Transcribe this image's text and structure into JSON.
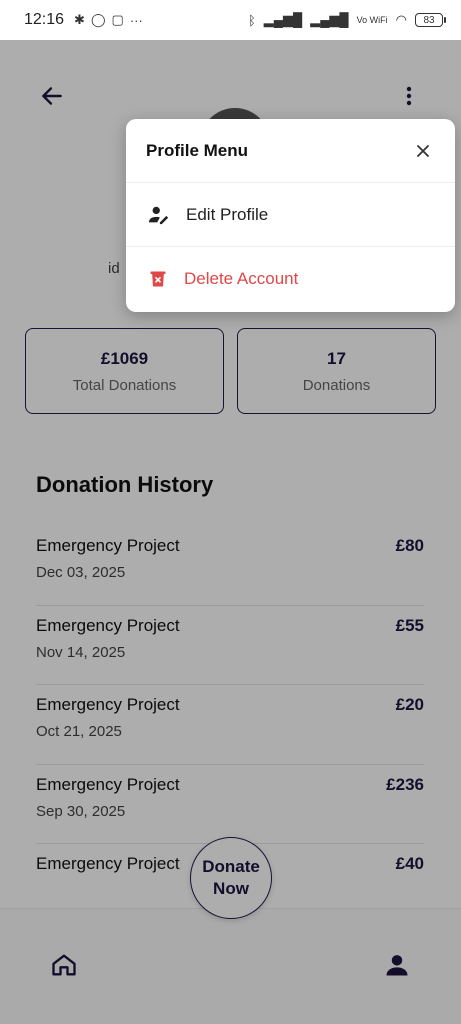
{
  "status_bar": {
    "time": "12:16",
    "left_icons": [
      "slack-icon",
      "whatsapp-icon",
      "calendar-icon",
      "more-dots-icon"
    ],
    "network_label": "Vo WiFi",
    "battery": "83"
  },
  "profile": {
    "handle": "id"
  },
  "stats": [
    {
      "value": "£1069",
      "label": "Total Donations"
    },
    {
      "value": "17",
      "label": "Donations"
    }
  ],
  "history": {
    "title": "Donation History",
    "items": [
      {
        "title": "Emergency Project",
        "date": "Dec 03, 2025",
        "amount": "£80"
      },
      {
        "title": "Emergency Project",
        "date": "Nov 14, 2025",
        "amount": "£55"
      },
      {
        "title": "Emergency Project",
        "date": "Oct 21, 2025",
        "amount": "£20"
      },
      {
        "title": "Emergency Project",
        "date": "Sep 30, 2025",
        "amount": "£236"
      },
      {
        "title": "Emergency Project",
        "date": "",
        "amount": "£40"
      }
    ]
  },
  "donate_button": {
    "line1": "Donate",
    "line2": "Now"
  },
  "menu": {
    "title": "Profile Menu",
    "items": [
      {
        "label": "Edit Profile",
        "icon": "edit-user-icon"
      },
      {
        "label": "Delete Account",
        "icon": "trash-icon"
      }
    ]
  },
  "colors": {
    "primary": "#1e1640",
    "danger": "#e04848"
  }
}
